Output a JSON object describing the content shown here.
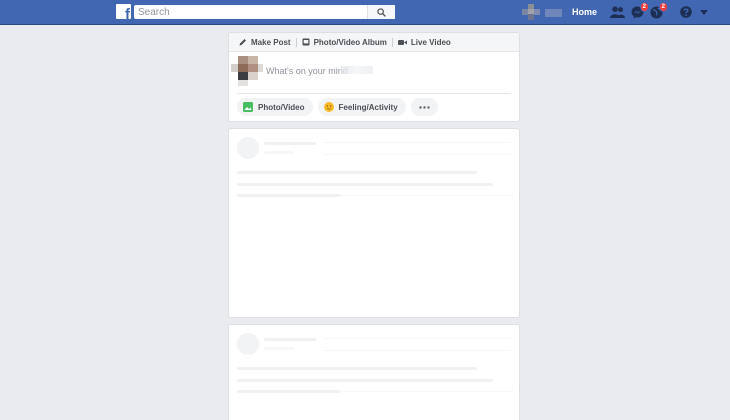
{
  "topbar": {
    "logo_letter": "f",
    "search_placeholder": "Search",
    "home_label": "Home",
    "messages_badge": "2",
    "notifications_badge": "2",
    "brand_color": "#4267b2"
  },
  "composer": {
    "tabs": [
      {
        "label": "Make Post",
        "icon": "pencil-icon"
      },
      {
        "label": "Photo/Video Album",
        "icon": "album-icon"
      },
      {
        "label": "Live Video",
        "icon": "video-camera-icon"
      }
    ],
    "prompt": "What's on your mind",
    "actions": [
      {
        "label": "Photo/Video",
        "icon": "photo-icon",
        "color": "#45bd62"
      },
      {
        "label": "Feeling/Activity",
        "icon": "smiley-icon",
        "color": "#f7b928"
      },
      {
        "label": "",
        "icon": "more-icon"
      }
    ]
  }
}
